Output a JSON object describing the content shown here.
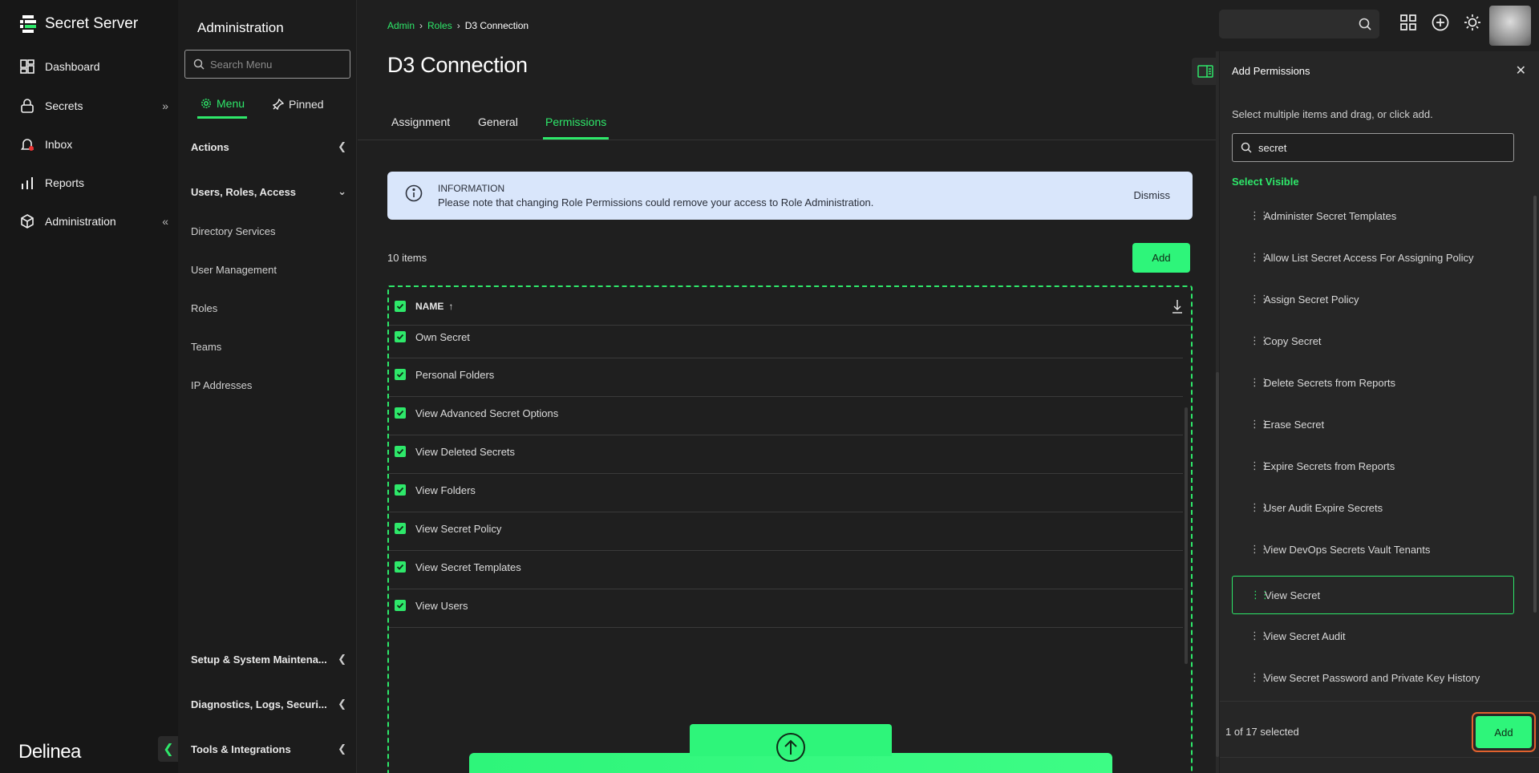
{
  "brand": {
    "name": "Secret Server",
    "footer_logo": "Delinea"
  },
  "leftnav": {
    "items": [
      {
        "label": "Dashboard",
        "icon": "dashboard-icon"
      },
      {
        "label": "Secrets",
        "icon": "lock-icon"
      },
      {
        "label": "Inbox",
        "icon": "bell-icon"
      },
      {
        "label": "Reports",
        "icon": "bar-chart-icon"
      },
      {
        "label": "Administration",
        "icon": "cube-icon"
      }
    ]
  },
  "adminmenu": {
    "title": "Administration",
    "search_placeholder": "Search Menu",
    "tabs": [
      {
        "label": "Menu"
      },
      {
        "label": "Pinned"
      }
    ],
    "groups": {
      "actions": "Actions",
      "users_roles": "Users, Roles, Access",
      "setup": "Setup & System Maintena...",
      "diagnostics": "Diagnostics, Logs, Securi...",
      "tools": "Tools & Integrations"
    },
    "links": [
      "Directory Services",
      "User Management",
      "Roles",
      "Teams",
      "IP Addresses"
    ]
  },
  "main": {
    "breadcrumbs": [
      "Admin",
      "Roles",
      "D3 Connection"
    ],
    "title": "D3 Connection",
    "tabs": [
      "Assignment",
      "General",
      "Permissions"
    ],
    "active_tab": "Permissions",
    "info": {
      "title": "INFORMATION",
      "message": "Please note that changing Role Permissions could remove your access to Role Administration.",
      "dismiss": "Dismiss"
    },
    "count": "10 items",
    "add_label": "Add",
    "grid": {
      "column": "NAME",
      "rows": [
        "Own Secret",
        "Personal Folders",
        "View Advanced Secret Options",
        "View Deleted Secrets",
        "View Folders",
        "View Secret Policy",
        "View Secret Templates",
        "View Users"
      ]
    }
  },
  "panel": {
    "title": "Add Permissions",
    "hint": "Select multiple items and drag, or click add.",
    "search_value": "secret",
    "select_visible": "Select Visible",
    "items": [
      "Administer Secret Templates",
      "Allow List Secret Access For Assigning Policy",
      "Assign Secret Policy",
      "Copy Secret",
      "Delete Secrets from Reports",
      "Erase Secret",
      "Expire Secrets from Reports",
      "User Audit Expire Secrets",
      "View DevOps Secrets Vault Tenants",
      "View Secret",
      "View Secret Audit",
      "View Secret Password and Private Key History"
    ],
    "selected_item": "View Secret",
    "selected_count": "1 of 17 selected",
    "add_label": "Add"
  },
  "colors": {
    "accent": "#2ee86a",
    "button": "#2ef57a",
    "info_bg": "#d9e6fb",
    "highlight_border": "#e2622e"
  }
}
